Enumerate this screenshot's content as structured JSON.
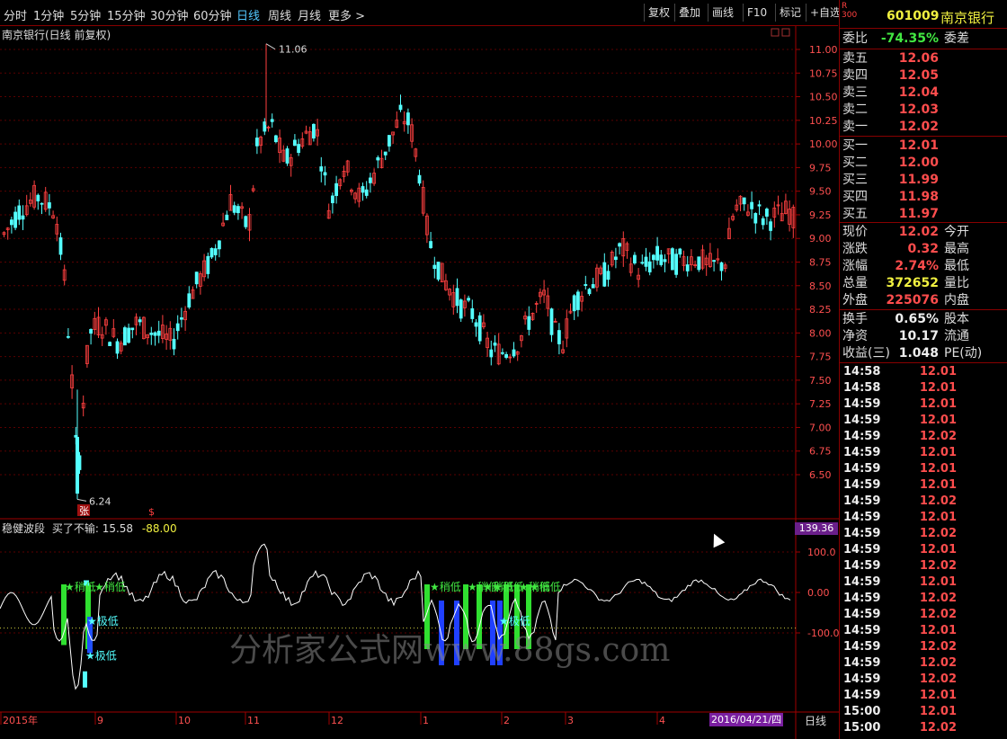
{
  "toolbar": {
    "tabs": [
      "分时",
      "1分钟",
      "5分钟",
      "15分钟",
      "30分钟",
      "60分钟",
      "日线",
      "周线",
      "月线",
      "更多 >"
    ],
    "active_tab": "日线",
    "buttons": [
      "复权",
      "叠加",
      "画线",
      "F10",
      "标记",
      "+自选"
    ]
  },
  "chart": {
    "title": "南京银行(日线 前复权)",
    "high_label": "11.06",
    "low_label": "6.24",
    "marker_zhang": "张",
    "marker_s": "$",
    "y_ticks": [
      "11.00",
      "10.75",
      "10.50",
      "10.25",
      "10.00",
      "9.75",
      "9.50",
      "9.25",
      "9.00",
      "8.75",
      "8.50",
      "8.25",
      "8.00",
      "7.75",
      "7.50",
      "7.25",
      "7.00",
      "6.75",
      "6.50"
    ],
    "indicator_title": "稳健波段",
    "indicator_sub": "买了不输: 15.58",
    "indicator_val": "-88.00",
    "indicator_badge": "139.36",
    "ind_ticks": [
      "100.0",
      "0.00",
      "-100.0"
    ],
    "signal_labels": [
      "稍低",
      "稍低",
      "极低",
      "极低",
      "稍低",
      "稍低",
      "稍低",
      "稍低",
      "稍低",
      "稍低",
      "极低"
    ],
    "watermark": "分析家公式网www.88gs.com",
    "x_axis": [
      "2015年",
      "9",
      "10",
      "11",
      "12",
      "1",
      "2",
      "3",
      "4"
    ],
    "date_badge": "2016/04/21/四",
    "period_label": "日线"
  },
  "panel": {
    "code_badge": "R\n300",
    "code": "601009",
    "name": "南京银行",
    "weibi_label": "委比",
    "weibi_value": "-74.35%",
    "weicha_label": "委差",
    "asks": [
      {
        "label": "卖五",
        "price": "12.06"
      },
      {
        "label": "卖四",
        "price": "12.05"
      },
      {
        "label": "卖三",
        "price": "12.04"
      },
      {
        "label": "卖二",
        "price": "12.03"
      },
      {
        "label": "卖一",
        "price": "12.02"
      }
    ],
    "bids": [
      {
        "label": "买一",
        "price": "12.01"
      },
      {
        "label": "买二",
        "price": "12.00"
      },
      {
        "label": "买三",
        "price": "11.99"
      },
      {
        "label": "买四",
        "price": "11.98"
      },
      {
        "label": "买五",
        "price": "11.97"
      }
    ],
    "stats": [
      {
        "l": "现价",
        "v": "12.02",
        "c": "red",
        "r": "今开"
      },
      {
        "l": "涨跌",
        "v": "0.32",
        "c": "red",
        "r": "最高"
      },
      {
        "l": "涨幅",
        "v": "2.74%",
        "c": "red",
        "r": "最低"
      },
      {
        "l": "总量",
        "v": "372652",
        "c": "yellow",
        "r": "量比"
      },
      {
        "l": "外盘",
        "v": "225076",
        "c": "red",
        "r": "内盘"
      }
    ],
    "stats2": [
      {
        "l": "换手",
        "v": "0.65%",
        "r": "股本"
      },
      {
        "l": "净资",
        "v": "10.17",
        "r": "流通"
      },
      {
        "l": "收益(三)",
        "v": "1.048",
        "r": "PE(动)"
      }
    ],
    "ticks": [
      {
        "t": "14:58",
        "p": "12.01"
      },
      {
        "t": "14:58",
        "p": "12.01"
      },
      {
        "t": "14:59",
        "p": "12.01"
      },
      {
        "t": "14:59",
        "p": "12.01"
      },
      {
        "t": "14:59",
        "p": "12.02"
      },
      {
        "t": "14:59",
        "p": "12.01"
      },
      {
        "t": "14:59",
        "p": "12.01"
      },
      {
        "t": "14:59",
        "p": "12.01"
      },
      {
        "t": "14:59",
        "p": "12.02"
      },
      {
        "t": "14:59",
        "p": "12.01"
      },
      {
        "t": "14:59",
        "p": "12.02"
      },
      {
        "t": "14:59",
        "p": "12.01"
      },
      {
        "t": "14:59",
        "p": "12.02"
      },
      {
        "t": "14:59",
        "p": "12.01"
      },
      {
        "t": "14:59",
        "p": "12.02"
      },
      {
        "t": "14:59",
        "p": "12.02"
      },
      {
        "t": "14:59",
        "p": "12.01"
      },
      {
        "t": "14:59",
        "p": "12.02"
      },
      {
        "t": "14:59",
        "p": "12.02"
      },
      {
        "t": "14:59",
        "p": "12.02"
      },
      {
        "t": "14:59",
        "p": "12.01"
      },
      {
        "t": "15:00",
        "p": "12.01"
      },
      {
        "t": "15:00",
        "p": "12.02"
      }
    ]
  },
  "colors": {
    "up": "#ff4040",
    "down": "#54ffff",
    "grid": "#5a0000",
    "axis": "#a00000"
  }
}
